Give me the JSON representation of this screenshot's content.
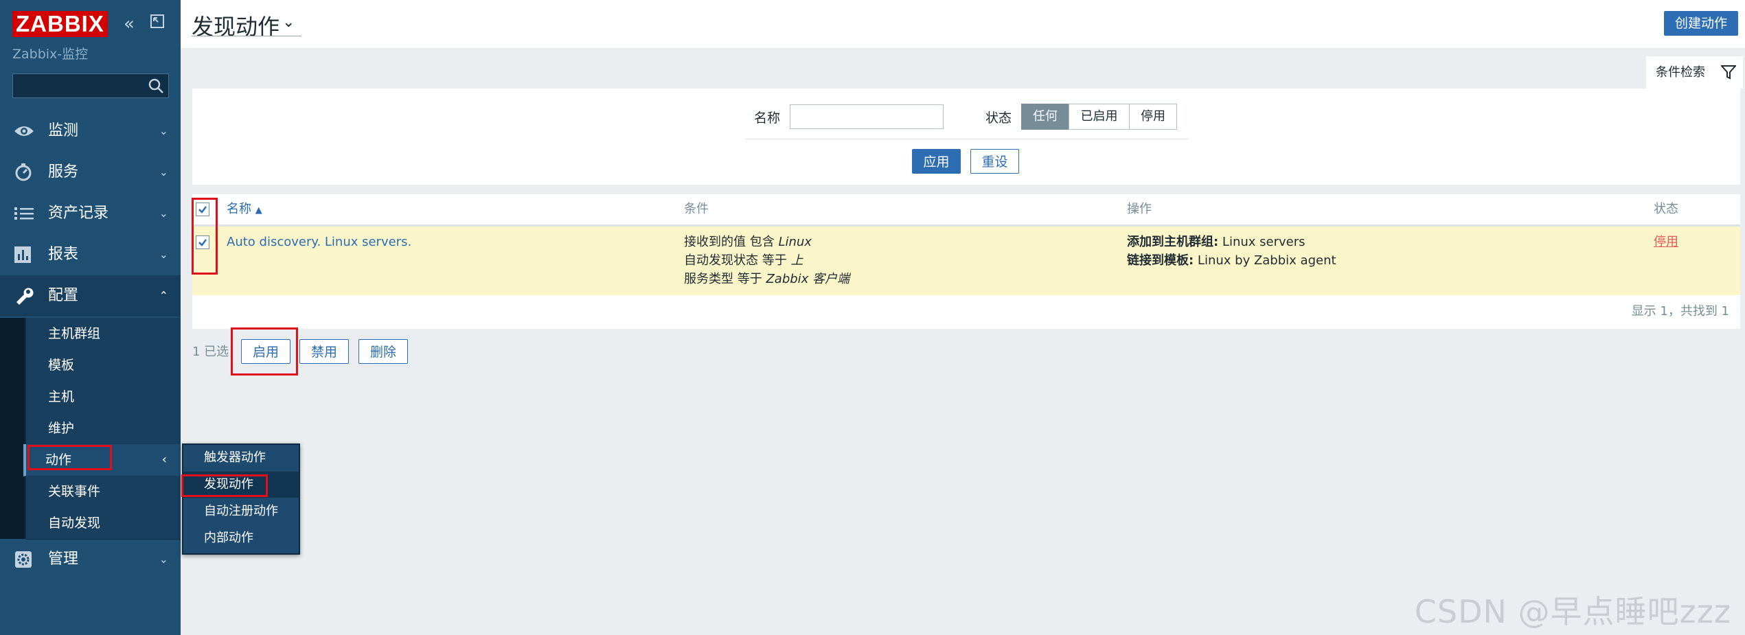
{
  "sidebar": {
    "logo": "ZABBIX",
    "server_name": "Zabbix-监控",
    "search_placeholder": "",
    "menu": [
      {
        "label": "监测",
        "icon": "eye-icon"
      },
      {
        "label": "服务",
        "icon": "clock-icon"
      },
      {
        "label": "资产记录",
        "icon": "list-icon"
      },
      {
        "label": "报表",
        "icon": "bar-chart-icon"
      },
      {
        "label": "配置",
        "icon": "wrench-icon"
      },
      {
        "label": "管理",
        "icon": "gear-icon"
      }
    ],
    "submenu": [
      "主机群组",
      "模板",
      "主机",
      "维护",
      "动作",
      "关联事件",
      "自动发现"
    ],
    "flyout": [
      "触发器动作",
      "发现动作",
      "自动注册动作",
      "内部动作"
    ]
  },
  "header": {
    "title": "发现动作",
    "create_button": "创建动作"
  },
  "filter": {
    "tab_label": "条件检索",
    "name_label": "名称",
    "name_value": "",
    "status_label": "状态",
    "status_options": [
      "任何",
      "已启用",
      "停用"
    ],
    "status_selected": "任何",
    "apply": "应用",
    "reset": "重设"
  },
  "table": {
    "columns": [
      "名称",
      "条件",
      "操作",
      "状态"
    ],
    "sort_indicator": "▲",
    "rows": [
      {
        "name": "Auto discovery. Linux servers.",
        "conditions": [
          {
            "text": "接收到的值 包含 ",
            "value": "Linux"
          },
          {
            "text": "自动发现状态 等于 ",
            "value": "上"
          },
          {
            "text": "服务类型 等于 ",
            "value": "Zabbix 客户端"
          }
        ],
        "operations": [
          {
            "label": "添加到主机群组:",
            "value": " Linux servers"
          },
          {
            "label": "链接到模板:",
            "value": " Linux by Zabbix agent"
          }
        ],
        "status": "停用"
      }
    ],
    "footer": "显示 1，共找到 1"
  },
  "mass_actions": {
    "selected": "1 已选",
    "enable": "启用",
    "disable": "禁用",
    "delete": "删除"
  },
  "watermark": "CSDN @早点睡吧zzz",
  "colors": {
    "sidebar_bg": "#1f4f73",
    "accent_blue": "#2d6db3",
    "row_highlight": "#fbf6c9",
    "status_disabled": "#e45959",
    "logo_red": "#d40000",
    "annotation_red": "#e0101a"
  }
}
